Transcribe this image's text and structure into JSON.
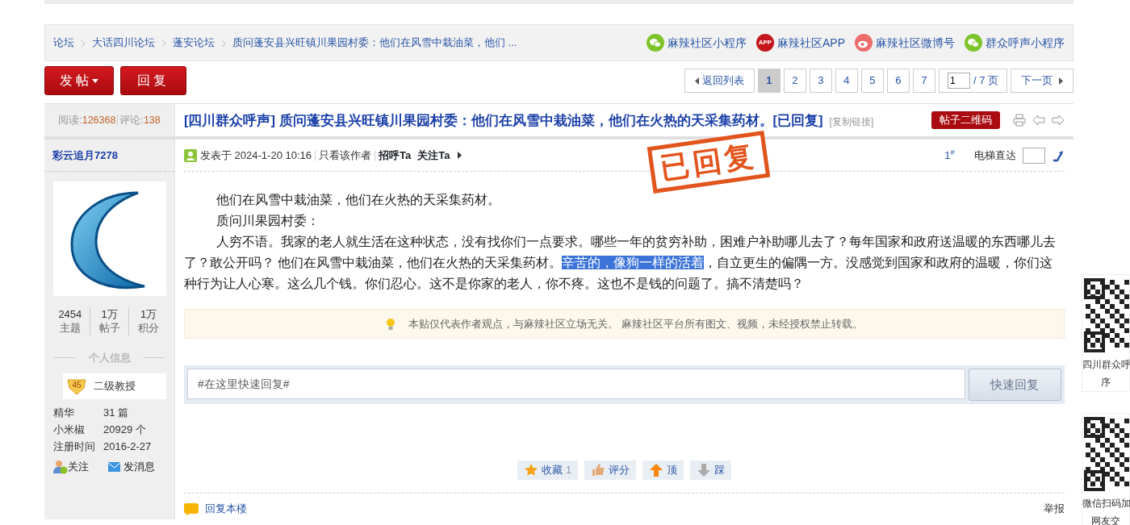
{
  "breadcrumb": [
    "论坛",
    "大话四川论坛",
    "蓬安论坛",
    "质问蓬安县兴旺镇川果园村委：他们在风雪中栽油菜，他们 ..."
  ],
  "channels": [
    {
      "kind": "wechat",
      "label": "麻辣社区小程序"
    },
    {
      "kind": "app",
      "label": "麻辣社区APP",
      "icon_text": "APP"
    },
    {
      "kind": "weibo",
      "label": "麻辣社区微博号"
    },
    {
      "kind": "wechat",
      "label": "群众呼声小程序"
    }
  ],
  "actions": {
    "post": "发帖",
    "reply": "回复"
  },
  "pagination": {
    "back": "返回列表",
    "pages": [
      {
        "label": "1",
        "selected": true
      },
      {
        "label": "2",
        "selected": false
      },
      {
        "label": "3",
        "selected": false
      },
      {
        "label": "4",
        "selected": false
      },
      {
        "label": "5",
        "selected": false
      },
      {
        "label": "6",
        "selected": false
      },
      {
        "label": "7",
        "selected": false
      }
    ],
    "page_input": "1",
    "total": "/ 7 页",
    "next": "下一页"
  },
  "stats": {
    "views_label": "阅读:",
    "views": "126368",
    "comments_label": "评论:",
    "comments": "138"
  },
  "thread": {
    "title": "[四川群众呼声] 质问蓬安县兴旺镇川果园村委：他们在风雪中栽油菜，他们在火热的天采集药材。[已回复]",
    "copy_link": "[复制链接]",
    "qr_button": "帖子二维码"
  },
  "author": {
    "name": "彩云追月7278",
    "stats": [
      {
        "value": "2454",
        "label": "主题"
      },
      {
        "value": "1万",
        "label": "帖子"
      },
      {
        "value": "1万",
        "label": "积分"
      }
    ],
    "info_heading": "个人信息",
    "level": "45",
    "rank": "二级教授",
    "info": [
      {
        "label": "精华",
        "value": "31 篇"
      },
      {
        "label": "小米椒",
        "value": "20929 个"
      },
      {
        "label": "注册时间",
        "value": "2016-2-27"
      }
    ],
    "follow": "关注",
    "message": "发消息"
  },
  "post": {
    "posted": "发表于 2024-1-20 10:16",
    "author_only": "只看该作者",
    "greet": "招呼Ta",
    "follow": "关注Ta",
    "floor": "1$^{#}$",
    "jump_label": "电梯直达",
    "stamp": "已回复",
    "paragraphs": [
      [
        {
          "text": "他们在风雪中栽油菜，他们在火热的天采集药材。",
          "selected": false
        }
      ],
      [
        {
          "text": "质问川果园村委：",
          "selected": false
        }
      ],
      [
        {
          "text": "人穷不语。我家的老人就生活在这种状态，没有找你们一点要求。哪些一年的贫穷补助，困难户补助哪儿去了？每年国家和政府送温暖的东西哪儿去了？敢公开吗？ 他们在风雪中栽油菜，他们在火热的天采集药材。",
          "selected": false
        },
        {
          "text": "辛苦的，像狗一样的活着",
          "selected": true
        },
        {
          "text": "，自立更生的偏隅一方。没感觉到国家和政府的温暖，你们这种行为让人心寒。这么几个钱。你们忍心。这不是你家的老人，你不疼。这也不是钱的问题了。搞不清楚吗？",
          "selected": false
        }
      ]
    ],
    "notice": "本贴仅代表作者观点，与麻辣社区立场无关。 麻辣社区平台所有图文、视频，未经授权禁止转载。",
    "quick_reply_placeholder": "#在这里快速回复#",
    "quick_reply_button": "快速回复",
    "buttons": [
      {
        "kind": "star",
        "label": "收藏",
        "count": "1"
      },
      {
        "kind": "thumb",
        "label": "评分"
      },
      {
        "kind": "up",
        "label": "顶"
      },
      {
        "kind": "down",
        "label": "踩"
      }
    ],
    "reply_floor": "回复本楼",
    "report": "举报"
  },
  "side_qr": [
    {
      "caption_lines": [
        "四川群众呼",
        "序"
      ]
    },
    {
      "caption_lines": [
        "微信扫码加",
        "网友交"
      ]
    }
  ]
}
